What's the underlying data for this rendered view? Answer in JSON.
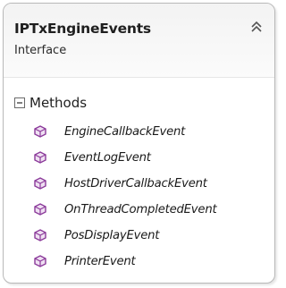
{
  "header": {
    "title": "IPTxEngineEvents",
    "subtitle": "Interface",
    "collapse_icon": "double-chevron-up-icon"
  },
  "section": {
    "label": "Methods",
    "toggle_icon": "collapse-minus-icon"
  },
  "methods": [
    {
      "label": "EngineCallbackEvent",
      "icon": "method-cube-icon"
    },
    {
      "label": "EventLogEvent",
      "icon": "method-cube-icon"
    },
    {
      "label": "HostDriverCallbackEvent",
      "icon": "method-cube-icon"
    },
    {
      "label": "OnThreadCompletedEvent",
      "icon": "method-cube-icon"
    },
    {
      "label": "PosDisplayEvent",
      "icon": "method-cube-icon"
    },
    {
      "label": "PrinterEvent",
      "icon": "method-cube-icon"
    }
  ],
  "colors": {
    "method_icon": "#8b3a9a",
    "border": "#b8b8b8",
    "header_bg": "#f3f3f3"
  }
}
